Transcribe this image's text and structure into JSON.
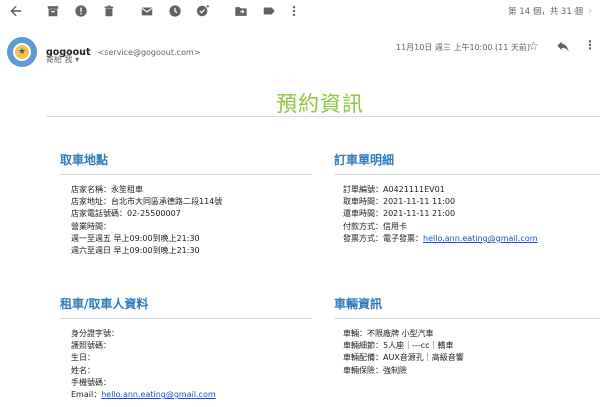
{
  "toolbar": {
    "pager": "第 14 個，共 31 個"
  },
  "header": {
    "sender_name": "gogoout",
    "sender_email": "<service@gogoout.com>",
    "to": "寄給 我 ▾",
    "date": "11月10日 週三 上午10:00 (11 天前)"
  },
  "email": {
    "title": "預約資訊",
    "pickup": {
      "heading": "取車地點",
      "store_name": "店家名稱：永笙租車",
      "store_address": "店家地址：台北市大同區承德路二段114號",
      "store_phone": "店家電話號碼：02-25500007",
      "hours_label": "營業時間：",
      "hours_weekday": "週一至週五 早上09:00到晚上21:30",
      "hours_weekend": "週六至週日 早上09:00到晚上21:30"
    },
    "order": {
      "heading": "訂車單明細",
      "order_no": "訂單編號：A0421111EV01",
      "pickup_time": "取車時間：2021-11-11 11:00",
      "return_time": "還車時間：2021-11-11 21:00",
      "payment": "付款方式：信用卡",
      "invoice_label": "發票方式：電子發票：",
      "invoice_email": "hello.ann.eating@gmail.com"
    },
    "renter": {
      "heading": "租車/取車人資料",
      "id_no": "身分證字號：",
      "passport": "護照號碼：",
      "birthday": "生日：",
      "name": "姓名：",
      "phone": "手機號碼：",
      "email_label": "Email：",
      "email_value": "hello.ann.eating@gmail.com"
    },
    "vehicle": {
      "heading": "車輛資訊",
      "car": "車輛：不限廠牌 小型汽車",
      "details": "車輛細節：5人座｜---cc｜轎車",
      "equipment": "車輛配備：AUX音源孔｜高級音響",
      "insurance": "車輛保險：強制險"
    }
  },
  "colors": {
    "title_green": "#8dc63f",
    "section_blue": "#2f7dc0",
    "link_blue": "#1a4fd6"
  }
}
